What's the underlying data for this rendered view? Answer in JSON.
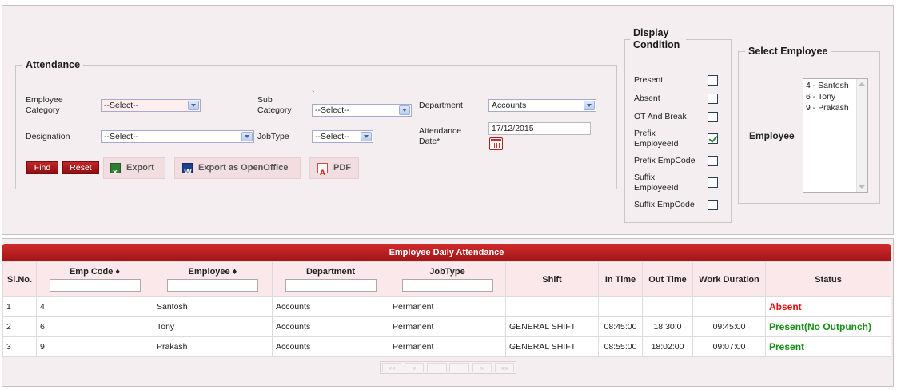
{
  "attendance": {
    "legend": "Attendance",
    "employee_category_label": "Employee Category",
    "employee_category_value": "--Select--",
    "sub_category_label": "Sub Category",
    "sub_category_value": "--Select--",
    "department_label": "Department",
    "department_value": "Accounts",
    "designation_label": "Designation",
    "designation_value": "--Select--",
    "jobtype_label": "JobType",
    "jobtype_value": "--Select--",
    "attendance_date_label": "Attendance Date*",
    "attendance_date_value": "17/12/2015",
    "stray_mark": "`",
    "find_label": "Find",
    "reset_label": "Reset",
    "export_label": "Export",
    "export_openoffice_label": "Export as OpenOffice",
    "pdf_label": "PDF"
  },
  "display_condition": {
    "legend": "Display Condition",
    "items": [
      {
        "label": "Present",
        "checked": false
      },
      {
        "label": "Absent",
        "checked": false
      },
      {
        "label": "OT And Break",
        "checked": false
      },
      {
        "label": "Prefix EmployeeId",
        "checked": true
      },
      {
        "label": "Prefix EmpCode",
        "checked": false
      },
      {
        "label": "Suffix EmployeeId",
        "checked": false
      },
      {
        "label": "Suffix EmpCode",
        "checked": false
      }
    ]
  },
  "select_employee": {
    "legend": "Select Employee",
    "employee_label": "Employee",
    "options": [
      "4 - Santosh",
      "6 - Tony",
      "9 - Prakash"
    ]
  },
  "grid": {
    "title": "Employee Daily Attendance",
    "columns": [
      "Sl.No.",
      "Emp Code ♦",
      "Employee ♦",
      "Department",
      "JobType",
      "Shift",
      "In Time",
      "Out Time",
      "Work Duration",
      "Status"
    ],
    "rows": [
      {
        "slno": "1",
        "emp_code": "4",
        "employee": "Santosh",
        "department": "Accounts",
        "jobtype": "Permanent",
        "shift": "",
        "in_time": "",
        "out_time": "",
        "work_duration": "",
        "status": "Absent"
      },
      {
        "slno": "2",
        "emp_code": "6",
        "employee": "Tony",
        "department": "Accounts",
        "jobtype": "Permanent",
        "shift": "GENERAL SHIFT",
        "in_time": "08:45:00",
        "out_time": "18:30:0",
        "work_duration": "09:45:00",
        "status": "Present(No Outpunch)"
      },
      {
        "slno": "3",
        "emp_code": "9",
        "employee": "Prakash",
        "department": "Accounts",
        "jobtype": "Permanent",
        "shift": "GENERAL SHIFT",
        "in_time": "08:55:00",
        "out_time": "18:02:00",
        "work_duration": "09:07:00",
        "status": "Present"
      }
    ]
  },
  "pager": {
    "first": "««",
    "prev": "«",
    "next": "»",
    "last": "»»"
  },
  "colors": {
    "grid_header_red": "#b8191b",
    "status_absent": "#e01212",
    "status_present": "#159015",
    "panel_bg": "#f4eef1"
  },
  "icons": {
    "calendar": "calendar-icon",
    "excel": "excel-icon",
    "word": "word-icon",
    "pdf": "pdf-icon"
  }
}
